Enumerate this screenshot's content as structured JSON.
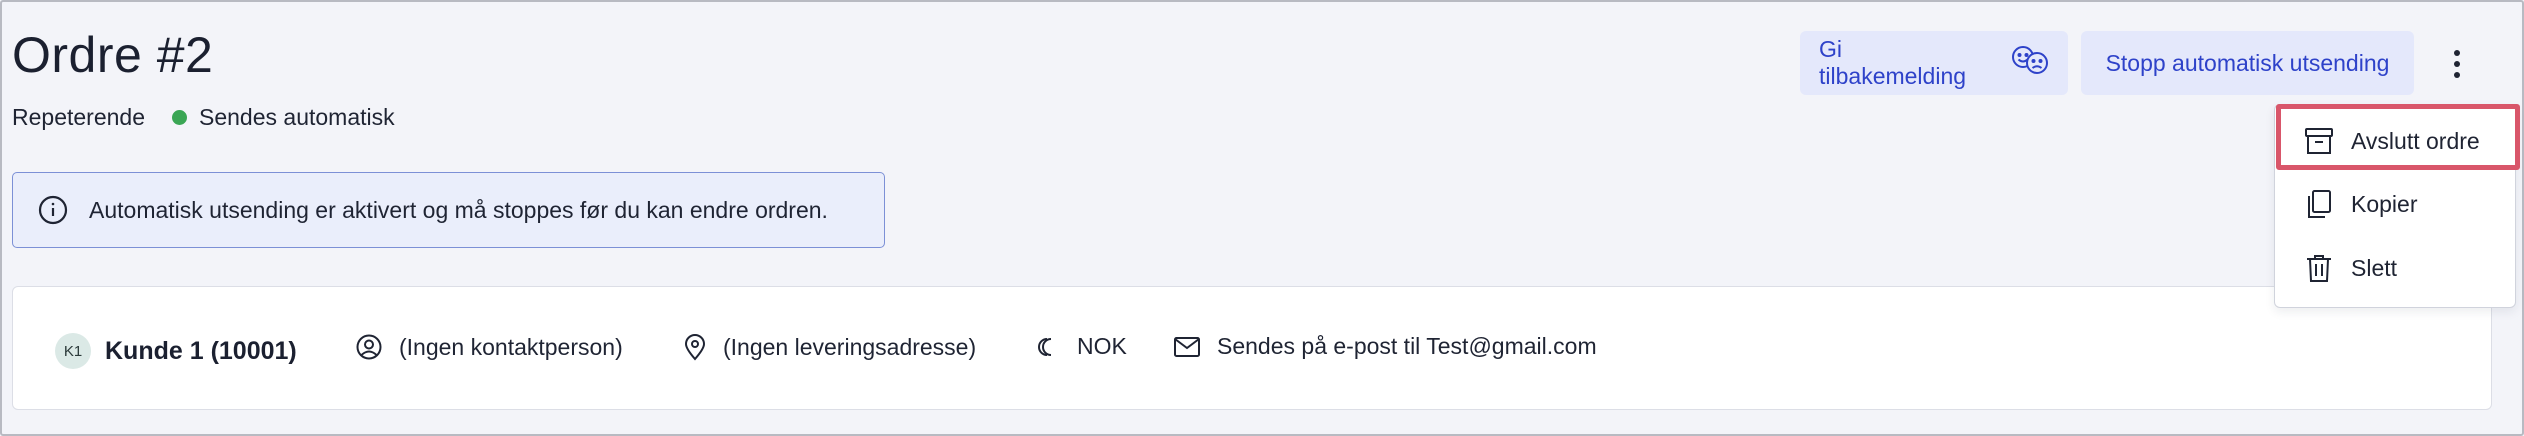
{
  "header": {
    "title": "Ordre #2",
    "order_type": "Repeterende",
    "status_text": "Sendes automatisk",
    "status_color": "#3aa655"
  },
  "toolbar": {
    "feedback_label": "Gi tilbakemelding",
    "feedback_icon": "smiley-faces-icon",
    "stop_label": "Stopp automatisk utsending",
    "more_icon": "kebab-vertical-icon"
  },
  "info_banner": {
    "icon": "info-icon",
    "text": "Automatisk utsending er aktivert og må stoppes før du kan endre ordren."
  },
  "customer": {
    "initials": "K1",
    "name": "Kunde 1 (10001)",
    "contact": "(Ingen kontaktperson)",
    "address": "(Ingen leveringsadresse)",
    "currency": "NOK",
    "delivery": "Sendes på e-post til Test@gmail.com"
  },
  "menu": {
    "items": [
      {
        "label": "Avslutt ordre",
        "icon": "archive-icon"
      },
      {
        "label": "Kopier",
        "icon": "copy-icon"
      },
      {
        "label": "Slett",
        "icon": "trash-icon"
      }
    ],
    "highlight_color": "#d9566a"
  },
  "colors": {
    "accent": "#2e42c9",
    "button_bg": "#e4e8fb",
    "info_border": "#7c90d6"
  }
}
